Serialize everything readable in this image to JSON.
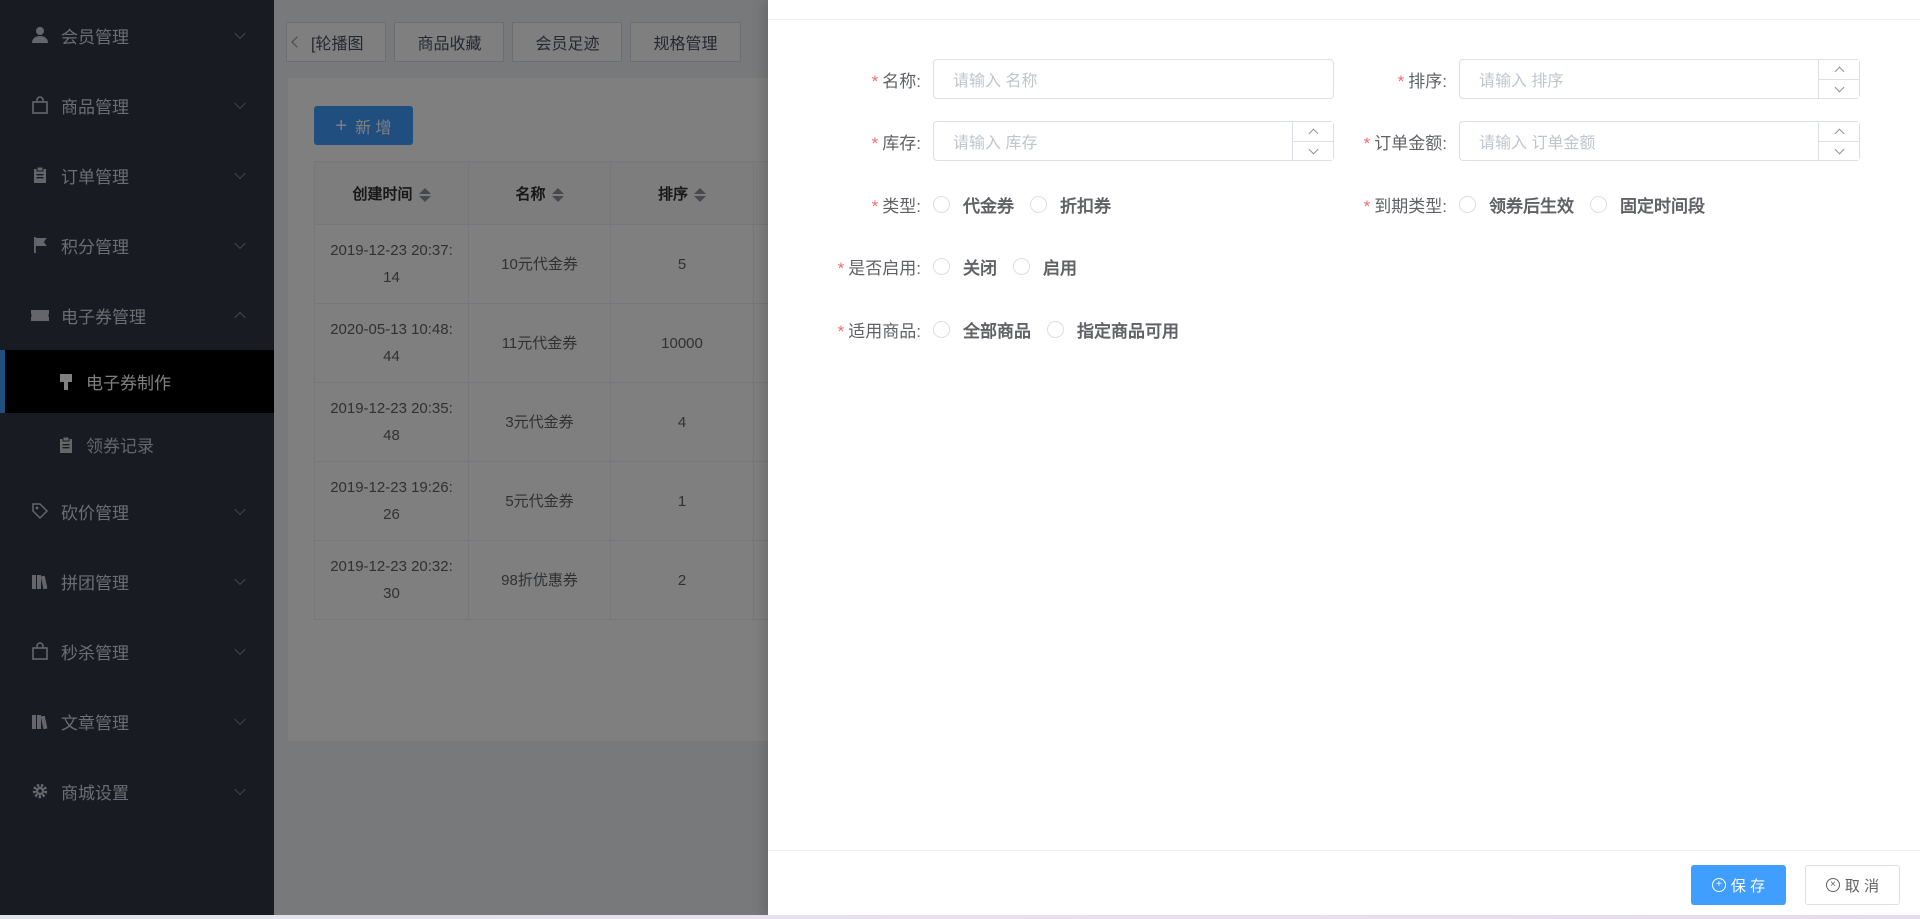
{
  "sidebar": {
    "items": [
      {
        "label": "会员管理",
        "icon": "user-icon"
      },
      {
        "label": "商品管理",
        "icon": "shopping-bag-icon"
      },
      {
        "label": "订单管理",
        "icon": "clipboard-icon"
      },
      {
        "label": "积分管理",
        "icon": "flag-icon"
      },
      {
        "label": "电子券管理",
        "icon": "ticket-icon",
        "expanded": true
      }
    ],
    "sub_items": [
      {
        "label": "电子券制作",
        "icon": "brush-icon",
        "active": true
      },
      {
        "label": "领券记录",
        "icon": "clipboard-icon"
      }
    ],
    "items_after": [
      {
        "label": "砍价管理",
        "icon": "tag-icon"
      },
      {
        "label": "拼团管理",
        "icon": "books-icon"
      },
      {
        "label": "秒杀管理",
        "icon": "shopping-bag-icon"
      },
      {
        "label": "文章管理",
        "icon": "books-icon"
      },
      {
        "label": "商城设置",
        "icon": "gear-icon"
      }
    ]
  },
  "tags": [
    "[轮播图",
    "商品收藏",
    "会员足迹",
    "规格管理"
  ],
  "toolbar": {
    "add_label": "新 增"
  },
  "table": {
    "headers": [
      "创建时间",
      "名称",
      "排序"
    ],
    "rows": [
      {
        "created": "2019-12-23 20:37:",
        "created2": "14",
        "name": "10元代金券",
        "sort": "5"
      },
      {
        "created": "2020-05-13 10:48:",
        "created2": "44",
        "name": "11元代金券",
        "sort": "10000"
      },
      {
        "created": "2019-12-23 20:35:",
        "created2": "48",
        "name": "3元代金券",
        "sort": "4"
      },
      {
        "created": "2019-12-23 19:26:",
        "created2": "26",
        "name": "5元代金券",
        "sort": "1"
      },
      {
        "created": "2019-12-23 20:32:",
        "created2": "30",
        "name": "98折优惠券",
        "sort": "2"
      }
    ]
  },
  "form": {
    "name": {
      "label": "名称:",
      "placeholder": "请输入 名称"
    },
    "sort": {
      "label": "排序:",
      "placeholder": "请输入 排序"
    },
    "stock": {
      "label": "库存:",
      "placeholder": "请输入 库存"
    },
    "order_amount": {
      "label": "订单金额:",
      "placeholder": "请输入 订单金额"
    },
    "type": {
      "label": "类型:",
      "options": [
        "代金券",
        "折扣券"
      ]
    },
    "expire_type": {
      "label": "到期类型:",
      "options": [
        "领券后生效",
        "固定时间段"
      ]
    },
    "enabled": {
      "label": "是否启用:",
      "options": [
        "关闭",
        "启用"
      ]
    },
    "applicable": {
      "label": "适用商品:",
      "options": [
        "全部商品",
        "指定商品可用"
      ]
    }
  },
  "footer": {
    "save_label": "保 存",
    "cancel_label": "取 消"
  },
  "colors": {
    "primary": "#409eff",
    "sidebar_bg": "#303643",
    "required": "#f56c6c"
  }
}
